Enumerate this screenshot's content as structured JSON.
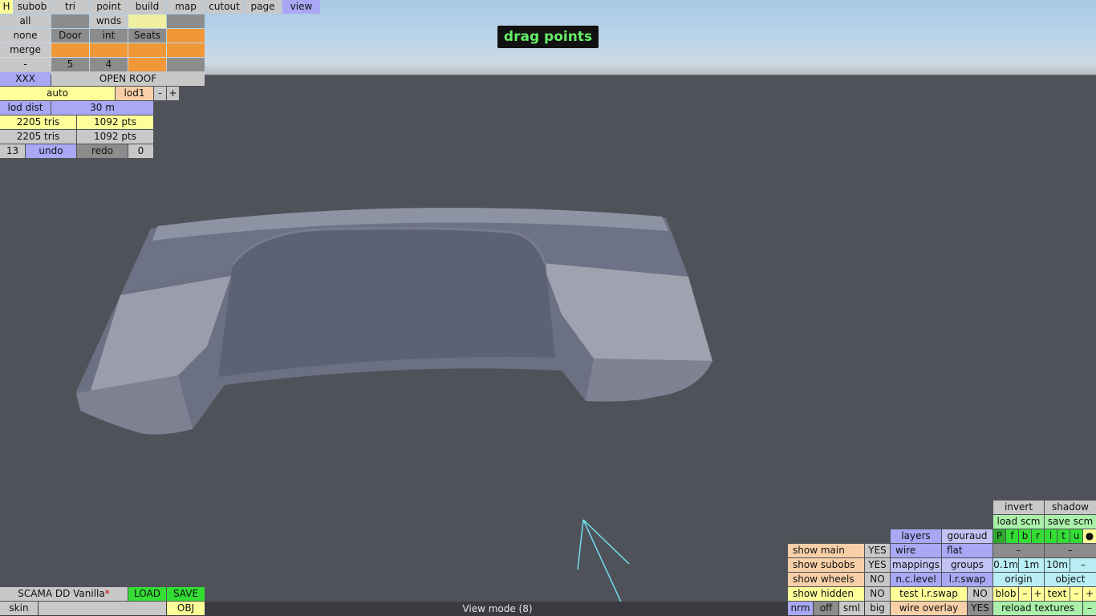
{
  "mode_banner": "drag points",
  "status_text": "View mode (8)",
  "menu": {
    "h": "H",
    "tabs": [
      "subob",
      "tri",
      "point",
      "build",
      "map",
      "cutout",
      "page",
      "view"
    ],
    "active_tab": "view"
  },
  "left_panel": {
    "r1": [
      "all",
      "",
      "wnds",
      ""
    ],
    "r2": [
      "none",
      "Door",
      "int",
      "Seats",
      ""
    ],
    "r3": [
      "merge",
      "",
      "",
      "",
      ""
    ],
    "r4": [
      "-",
      "5",
      "4",
      "",
      ""
    ],
    "xxx": "XXX",
    "open_roof": "OPEN ROOF",
    "auto": "auto",
    "lod": "lod1",
    "lod_minus": "-",
    "lod_plus": "+",
    "lod_dist_label": "lod dist",
    "lod_dist_value": "30 m",
    "tris1": "2205 tris",
    "pts1": "1092 pts",
    "tris2": "2205 tris",
    "pts2": "1092 pts",
    "undo_count": "13",
    "undo": "undo",
    "redo": "redo",
    "redo_count": "0"
  },
  "bottom_left": {
    "name": "SCAMA DD Vanilla",
    "modified_mark": "*",
    "load": "LOAD",
    "save": "SAVE",
    "skin": "skin",
    "obj": "OBJ"
  },
  "bottom_right": {
    "invert": "invert",
    "shadow": "shadow",
    "load_scm": "load scm",
    "save_scm": "save scm",
    "letters": [
      "P",
      "f",
      "b",
      "r",
      "l",
      "t",
      "u",
      "●"
    ],
    "layers": "layers",
    "gouraud": "gouraud",
    "dash1": "–",
    "dash2": "–",
    "show_main": "show main",
    "show_main_val": "YES",
    "wire": "wire",
    "flat": "flat",
    "show_subobs": "show subobs",
    "show_subobs_val": "YES",
    "mappings": "mappings",
    "groups": "groups",
    "step_01": "0.1m",
    "step_1": "1m",
    "step_10": "10m",
    "step_minus": "–",
    "show_wheels": "show wheels",
    "show_wheels_val": "NO",
    "nc_level": "n.c.level",
    "lr_swap": "l.r.swap",
    "origin": "origin",
    "object": "object",
    "show_hidden": "show hidden",
    "show_hidden_val": "NO",
    "test_lr_swap": "test l.r.swap",
    "test_lr_swap_val": "NO",
    "blob": "blob",
    "blob_minus": "–",
    "blob_plus": "+",
    "text": "text",
    "text_minus": "–",
    "text_plus": "+",
    "nrm": "nrm",
    "off": "off",
    "sml": "sml",
    "big": "big",
    "wire_overlay": "wire overlay",
    "wire_overlay_val": "YES",
    "reload_textures": "reload textures",
    "reload_minus": "–"
  },
  "colors": {
    "sky_top": "#a8c8e4",
    "floor": "#50525a",
    "model": "#7a7f8e",
    "banner_text": "#66ee66",
    "gizmo": "#6fe0f0"
  }
}
